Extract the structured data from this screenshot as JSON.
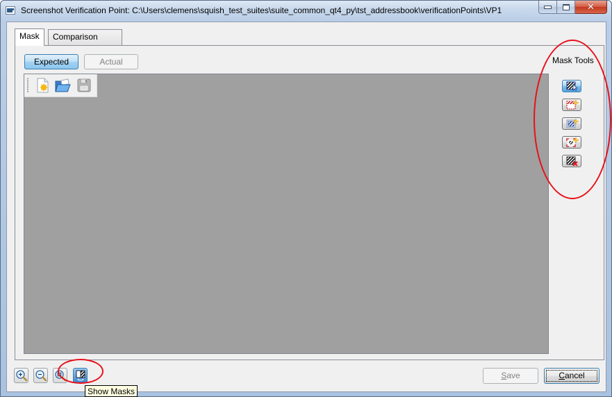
{
  "window": {
    "title": "Screenshot Verification Point: C:\\Users\\clemens\\squish_test_suites\\suite_common_qt4_py\\tst_addressbook\\verificationPoints\\VP1",
    "icon": "window-app-icon",
    "controls": {
      "minimize": "minimize-icon",
      "maximize": "maximize-icon",
      "close": "close-icon",
      "close_glyph": "✕"
    }
  },
  "tabs": [
    {
      "label": "Mask",
      "active": true
    },
    {
      "label": "Comparison Mode",
      "active": false
    }
  ],
  "mode_buttons": {
    "expected": {
      "label": "Expected",
      "active": true
    },
    "actual": {
      "label": "Actual",
      "enabled": false
    }
  },
  "image_toolbar": {
    "items": [
      {
        "name": "new-mask-file",
        "icon": "new-document-icon"
      },
      {
        "name": "open-mask-file",
        "icon": "open-folder-icon"
      },
      {
        "name": "save-mask-file",
        "icon": "floppy-disk-icon",
        "enabled": false
      }
    ]
  },
  "mask_tools": {
    "label": "Mask Tools",
    "tools": [
      {
        "name": "select-mask",
        "icon": "select-mask-icon",
        "active": true
      },
      {
        "name": "add-positive-mask",
        "icon": "add-positive-mask-icon"
      },
      {
        "name": "add-negative-mask",
        "icon": "add-negative-mask-icon"
      },
      {
        "name": "add-mask-region",
        "icon": "add-mask-region-icon"
      },
      {
        "name": "remove-mask",
        "icon": "remove-mask-icon"
      }
    ]
  },
  "bottom_tools": [
    {
      "name": "zoom-in",
      "icon": "zoom-in-icon"
    },
    {
      "name": "zoom-out",
      "icon": "zoom-out-icon"
    },
    {
      "name": "zoom-original",
      "icon": "zoom-original-icon"
    },
    {
      "name": "show-masks",
      "icon": "show-masks-icon",
      "active": true
    }
  ],
  "tooltip": {
    "text": "Show Masks"
  },
  "dialog_buttons": {
    "save": {
      "label_mnemonic": "S",
      "label_rest": "ave",
      "enabled": false
    },
    "cancel": {
      "label_mnemonic": "C",
      "label_rest": "ancel",
      "focused": true
    }
  },
  "colors": {
    "canvas": "#a0a0a0",
    "annotation": "#e8101a",
    "active_button": "#3c7fb1",
    "tooltip_bg": "#ffffe1"
  }
}
